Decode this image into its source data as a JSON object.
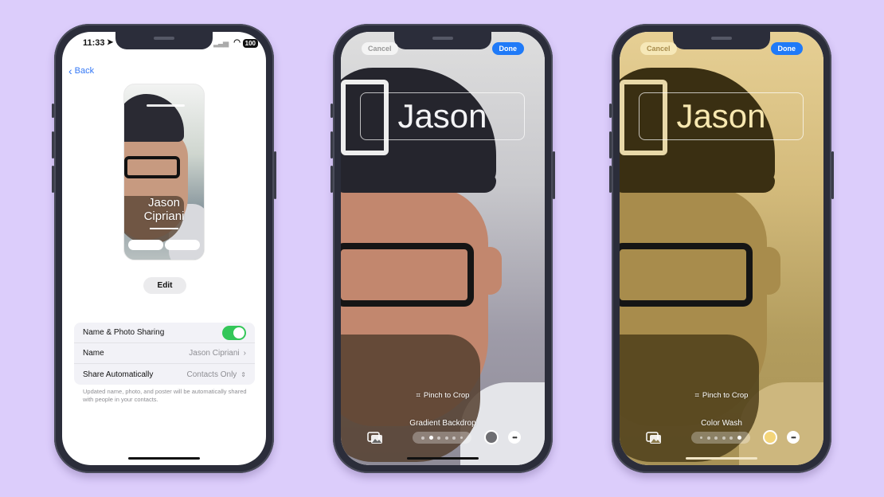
{
  "background_color": "#dccdfb",
  "phone1": {
    "status_bar": {
      "time": "11:33",
      "location_icon": "location-arrow-icon",
      "battery": "100"
    },
    "back_label": "Back",
    "poster": {
      "first_name": "Jason",
      "last_name": "Cipriani"
    },
    "edit_label": "Edit",
    "settings": {
      "rows": [
        {
          "label": "Name & Photo Sharing",
          "toggle_on": true
        },
        {
          "label": "Name",
          "value": "Jason Cipriani"
        },
        {
          "label": "Share Automatically",
          "value": "Contacts Only"
        }
      ],
      "footnote": "Updated name, photo, and poster will be automatically shared with people in your contacts."
    },
    "accent_color": "#3478f6",
    "toggle_color": "#34c759"
  },
  "phone2": {
    "cancel_label": "Cancel",
    "done_label": "Done",
    "poster_name": "Jason",
    "crop_hint": "Pinch to Crop",
    "style_name": "Gradient Backdrop",
    "style_dots": {
      "count": 6,
      "active_index": 1
    },
    "swatch_color": "#6e6e72",
    "more_label": "•••"
  },
  "phone3": {
    "cancel_label": "Cancel",
    "done_label": "Done",
    "poster_name": "Jason",
    "crop_hint": "Pinch to Crop",
    "style_name": "Color Wash",
    "style_dots": {
      "count": 6,
      "active_index": 5
    },
    "swatch_color": "#f4d57a",
    "more_label": "•••"
  }
}
